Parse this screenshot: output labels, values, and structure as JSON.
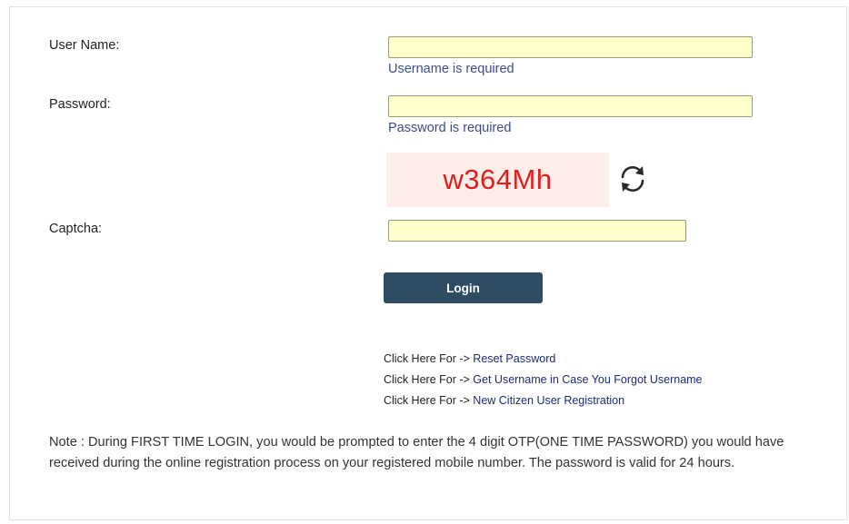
{
  "form": {
    "username": {
      "label": "User Name:",
      "value": "",
      "error": "Username is required"
    },
    "password": {
      "label": "Password:",
      "value": "",
      "error": "Password is required"
    },
    "captcha": {
      "code": "w364Mh",
      "refresh_icon": "refresh-icon",
      "label": "Captcha:",
      "value": ""
    },
    "login_label": "Login"
  },
  "links": [
    {
      "prefix": "Click Here For ->",
      "text": "Reset Password"
    },
    {
      "prefix": "Click Here For ->",
      "text": "Get Username in Case You Forgot Username"
    },
    {
      "prefix": "Click Here For ->",
      "text": "New Citizen User Registration"
    }
  ],
  "note": "Note : During FIRST TIME LOGIN, you would be prompted to enter the 4 digit OTP(ONE TIME PASSWORD) you would have received during the online registration process on your registered mobile number. The password is valid for 24 hours.",
  "colors": {
    "field_bg": "#ffffcc",
    "error_text": "#3d4d8a",
    "captcha_text": "#e01e1e",
    "captcha_bg": "#fdeeea",
    "button_bg": "#2e4d63",
    "link_text": "#1d2a7a"
  }
}
